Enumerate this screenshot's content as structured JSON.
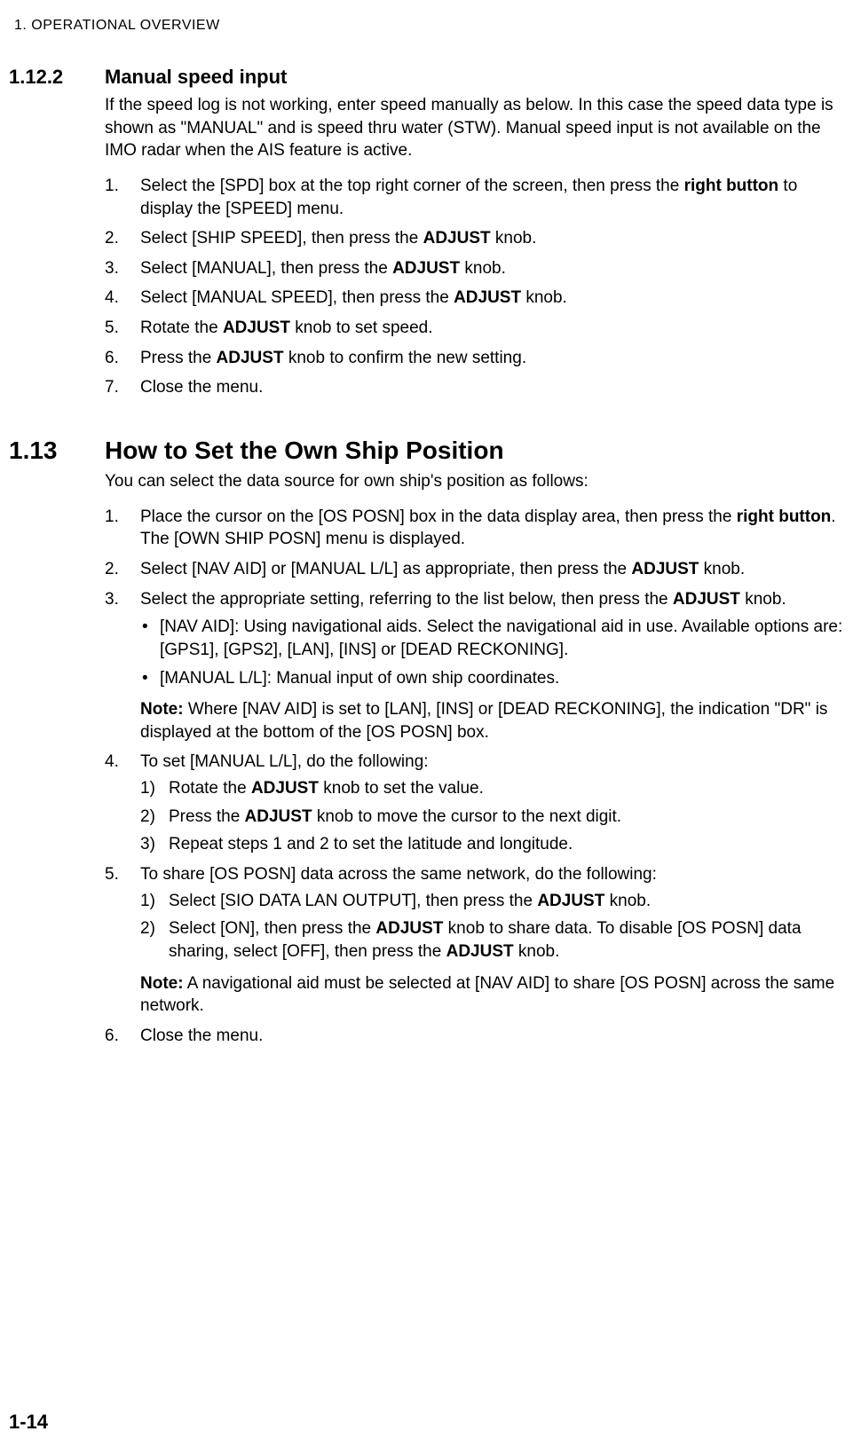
{
  "header": "1.  OPERATIONAL OVERVIEW",
  "page_number": "1-14",
  "s1": {
    "num": "1.12.2",
    "title": "Manual speed input",
    "intro": "If the speed log is not working, enter speed manually as below. In this case the speed data type is shown as \"MANUAL\" and is speed thru water (STW). Manual speed input is not available on the IMO radar when the AIS feature is active.",
    "step1a": "Select the [SPD] box at the top right corner of the screen, then press the ",
    "step1b": "right button",
    "step1c": " to display the [SPEED] menu.",
    "step2a": "Select [SHIP SPEED], then press the ",
    "step2b": "ADJUST",
    "step2c": " knob.",
    "step3a": "Select [MANUAL], then press the ",
    "step3b": "ADJUST",
    "step3c": " knob.",
    "step4a": "Select [MANUAL SPEED], then press the ",
    "step4b": "ADJUST",
    "step4c": " knob.",
    "step5a": "Rotate the ",
    "step5b": "ADJUST",
    "step5c": " knob to set speed.",
    "step6a": "Press the ",
    "step6b": "ADJUST",
    "step6c": " knob to confirm the new setting.",
    "step7": "Close the menu."
  },
  "s2": {
    "num": "1.13",
    "title": "How to Set the Own Ship Position",
    "intro": "You can select the data source for own ship's position as follows:",
    "step1a": "Place the cursor on the [OS POSN] box in the data display area, then press the ",
    "step1b": "right button",
    "step1c": ". The [OWN SHIP POSN] menu is displayed.",
    "step2a": "Select [NAV AID] or [MANUAL L/L] as appropriate, then press the ",
    "step2b": "ADJUST",
    "step2c": " knob.",
    "step3a": "Select the appropriate setting, referring to the list below, then press the ",
    "step3b": "ADJUST",
    "step3c": " knob.",
    "b1": "[NAV AID]: Using navigational aids. Select the navigational aid in use. Available options are: [GPS1], [GPS2], [LAN], [INS] or [DEAD RECKONING].",
    "b2": "[MANUAL L/L]: Manual input of own ship coordinates.",
    "note1label": "Note:",
    "note1": " Where [NAV AID] is set to [LAN], [INS] or [DEAD RECKONING], the indication \"DR\" is displayed at the bottom of the [OS POSN] box.",
    "step4": "To set [MANUAL L/L], do the following:",
    "s4s1a": "Rotate the ",
    "s4s1b": "ADJUST",
    "s4s1c": " knob to set the value.",
    "s4s2a": "Press the ",
    "s4s2b": "ADJUST",
    "s4s2c": " knob to move the cursor to the next digit.",
    "s4s3": "Repeat steps 1 and 2 to set the latitude and longitude.",
    "step5": "To share [OS POSN] data across the same network, do the following:",
    "s5s1a": "Select [SIO DATA LAN OUTPUT], then press the ",
    "s5s1b": "ADJUST",
    "s5s1c": " knob.",
    "s5s2a": "Select [ON], then press the ",
    "s5s2b": "ADJUST",
    "s5s2c": " knob to share data. To disable [OS POSN] data sharing, select [OFF], then press the ",
    "s5s2d": "ADJUST",
    "s5s2e": " knob.",
    "note2label": "Note:",
    "note2": " A navigational aid must be selected at [NAV AID] to share [OS POSN] across the same network.",
    "step6": "Close the menu."
  }
}
